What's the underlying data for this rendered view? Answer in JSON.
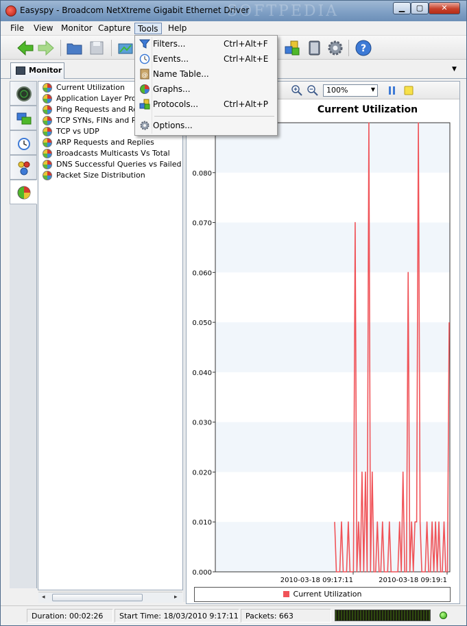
{
  "window": {
    "title": "Easyspy - Broadcom NetXtreme Gigabit Ethernet Driver",
    "watermark": "SOFTPEDIA"
  },
  "menubar": {
    "items": [
      "File",
      "View",
      "Monitor",
      "Capture",
      "Tools",
      "Help"
    ],
    "active": "Tools"
  },
  "tools_menu": {
    "items": [
      {
        "label": "Filters...",
        "shortcut": "Ctrl+Alt+F",
        "icon": "funnel-icon"
      },
      {
        "label": "Events...",
        "shortcut": "Ctrl+Alt+E",
        "icon": "clock-icon"
      },
      {
        "label": "Name Table...",
        "shortcut": "",
        "icon": "name-table-icon"
      },
      {
        "label": "Graphs...",
        "shortcut": "",
        "icon": "pie-chart-icon"
      },
      {
        "label": "Protocols...",
        "shortcut": "Ctrl+Alt+P",
        "icon": "protocols-icon"
      },
      {
        "label": "Options...",
        "shortcut": "",
        "icon": "gear-icon"
      }
    ]
  },
  "tabs": {
    "monitor_label": "Monitor"
  },
  "tree": {
    "items": [
      "Current Utilization",
      "Application Layer Protocols",
      "Ping Requests and Replies",
      "TCP SYNs, FINs and RSTs",
      "TCP vs UDP",
      "ARP Requests and Replies",
      "Broadcasts Multicasts Vs Total",
      "DNS Successful Queries vs Failed Queries",
      "Packet Size Distribution"
    ],
    "selected": 0
  },
  "chart_toolbar": {
    "zoom": "100%"
  },
  "chart_data": {
    "type": "line",
    "title": "Current Utilization",
    "xlabel": "",
    "ylabel": "",
    "ylim": [
      0,
      0.09
    ],
    "yticks": [
      "0.000",
      "0.010",
      "0.020",
      "0.030",
      "0.040",
      "0.050",
      "0.060",
      "0.070",
      "0.080"
    ],
    "xticks": [
      "2010-03-18 09:17:11",
      "2010-03-18 09:19:1"
    ],
    "grid": "alternating horizontal bands",
    "legend_position": "bottom",
    "series": [
      {
        "name": "Current Utilization",
        "color": "#f05358",
        "values": [
          0.01,
          0,
          0,
          0,
          0.01,
          0,
          0,
          0,
          0.01,
          0,
          0,
          0,
          0.07,
          0,
          0.01,
          0,
          0.02,
          0,
          0.02,
          0,
          0.09,
          0,
          0.02,
          0,
          0,
          0.01,
          0,
          0,
          0.01,
          0,
          0,
          0,
          0.01,
          0,
          0,
          0,
          0,
          0,
          0.01,
          0,
          0.02,
          0,
          0,
          0.06,
          0,
          0.01,
          0,
          0.01,
          0.01,
          0.09,
          0.01,
          0,
          0,
          0,
          0.01,
          0,
          0,
          0.01,
          0,
          0.01,
          0,
          0.01,
          0,
          0,
          0.01,
          0,
          0,
          0.05
        ]
      }
    ]
  },
  "status": {
    "duration": "Duration: 00:02:26",
    "start_time": "Start Time: 18/03/2010 9:17:11",
    "packets": "Packets: 663"
  }
}
